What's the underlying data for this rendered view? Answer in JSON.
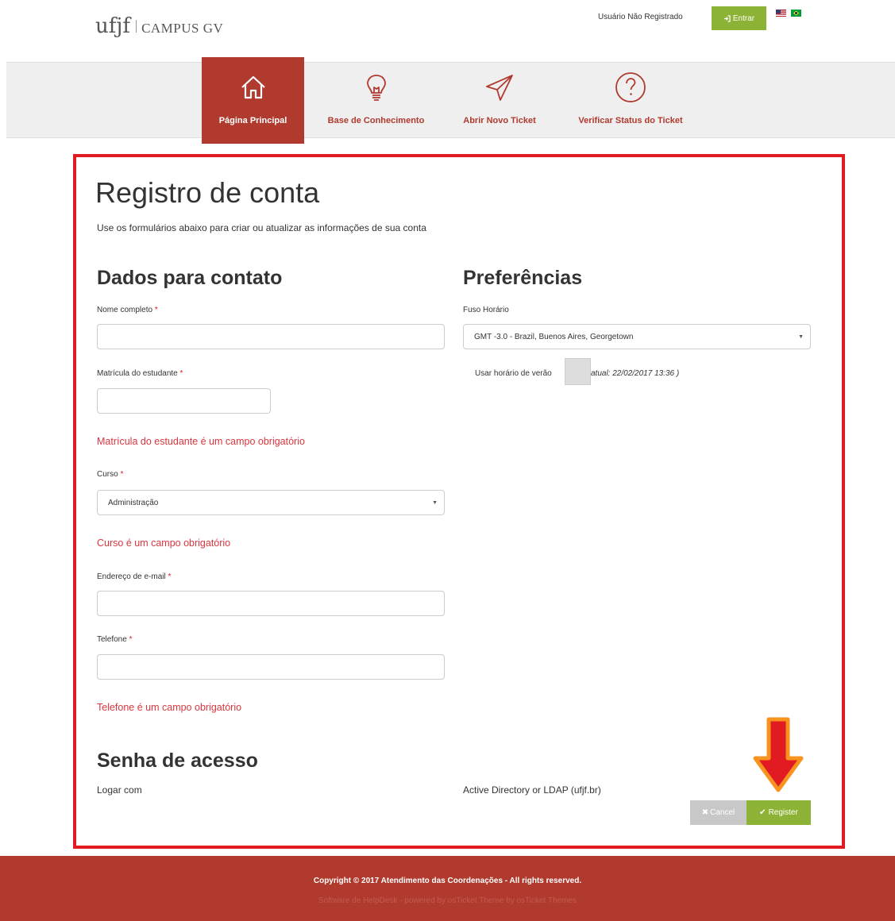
{
  "header": {
    "logo_text": "ufjf",
    "logo_subtitle": "CAMPUS GV",
    "user_status": "Usuário Não Registrado",
    "login_label": "Entrar"
  },
  "nav": {
    "items": [
      {
        "label": "Página Principal",
        "icon": "home-icon",
        "active": true
      },
      {
        "label": "Base de Conhecimento",
        "icon": "lightbulb-icon",
        "active": false
      },
      {
        "label": "Abrir Novo Ticket",
        "icon": "paper-plane-icon",
        "active": false
      },
      {
        "label": "Verificar Status do Ticket",
        "icon": "question-circle-icon",
        "active": false
      }
    ]
  },
  "page": {
    "title": "Registro de conta",
    "intro": "Use os formulários abaixo para criar ou atualizar as informações de sua conta"
  },
  "contact": {
    "heading": "Dados para contato",
    "full_name_label": "Nome completo",
    "full_name_value": "",
    "student_id_label": "Matrícula do estudante",
    "student_id_value": "",
    "student_id_error": "Matrícula do estudante é um campo obrigatório",
    "course_label": "Curso",
    "course_value": "Administração",
    "course_error": "Curso é um campo obrigatório",
    "email_label": "Endereço de e-mail",
    "email_value": "",
    "phone_label": "Telefone",
    "phone_value": "",
    "phone_error": "Telefone é um campo obrigatório",
    "required_mark": "*"
  },
  "preferences": {
    "heading": "Preferências",
    "timezone_label": "Fuso Horário",
    "timezone_value": "GMT -3.0 - Brazil, Buenos Aires, Georgetown",
    "dst_label": "Usar horário de verão",
    "dst_current": "atual: 22/02/2017 13:36 )"
  },
  "password": {
    "heading": "Senha de acesso",
    "logon_label": "Logar com",
    "logon_value": "Active Directory or LDAP (ufjf.br)"
  },
  "actions": {
    "cancel_label": "Cancel",
    "register_label": "Register"
  },
  "footer": {
    "copyright": "Copyright © 2017 Atendimento das Coordenações - All rights reserved.",
    "links": "Software de HelpDesk - powered by osTicket    Theme by osTicket Themes"
  },
  "colors": {
    "brand_red": "#b03a2e",
    "accent_green": "#8cb335",
    "highlight_frame": "#e21b23",
    "error_text": "#d9363e",
    "arrow_orange": "#f7931e"
  }
}
